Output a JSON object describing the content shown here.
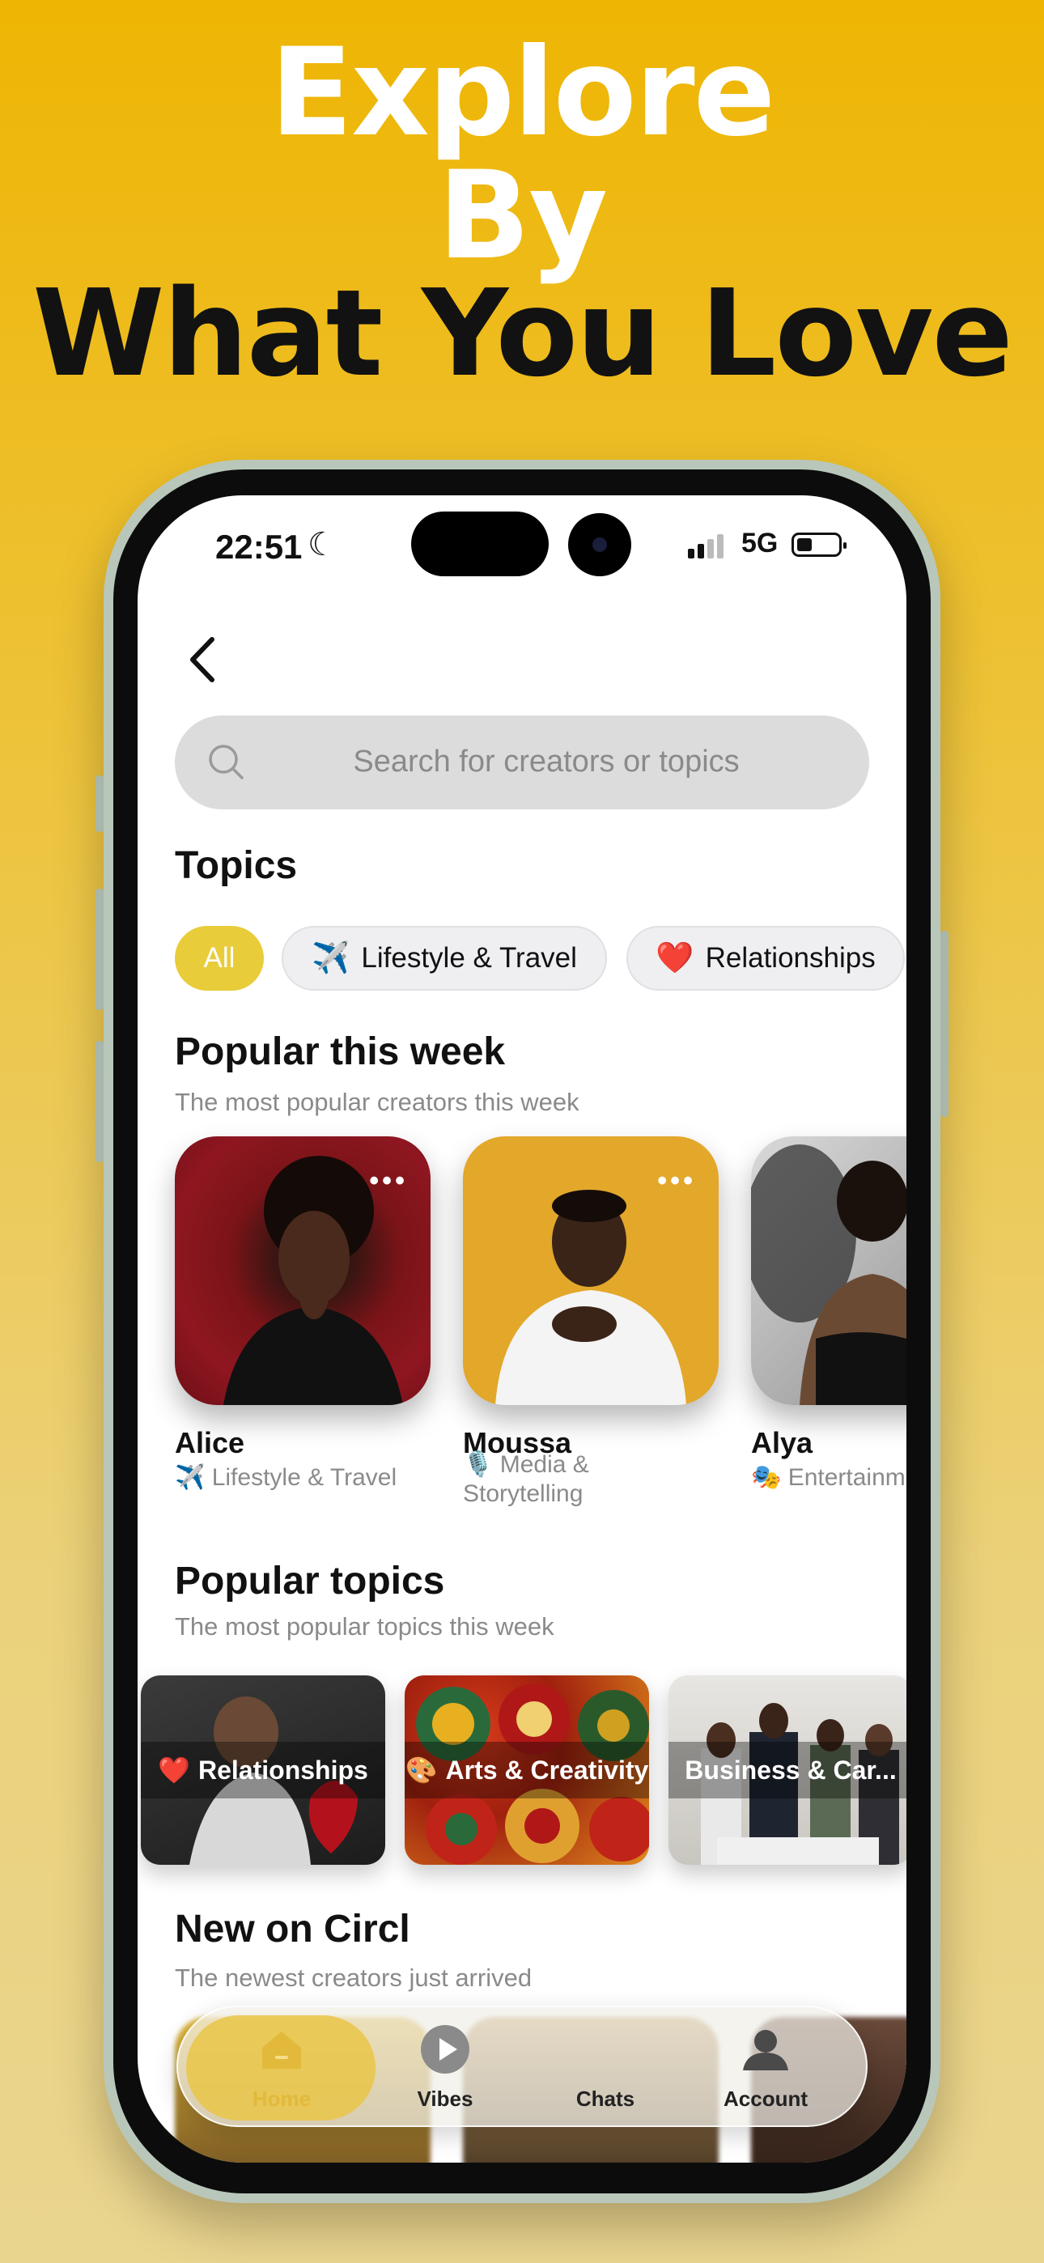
{
  "promo": {
    "line1": "Explore",
    "line2": "By",
    "line3": "What You Love"
  },
  "status_bar": {
    "time": "22:51",
    "network": "5G",
    "icons": [
      "moon-icon",
      "signal-icon",
      "battery-icon"
    ]
  },
  "search": {
    "placeholder": "Search for creators or topics"
  },
  "topics": {
    "title": "Topics",
    "chips": [
      {
        "label": "All",
        "emoji": "",
        "active": true
      },
      {
        "label": "Lifestyle & Travel",
        "emoji": "✈️",
        "active": false
      },
      {
        "label": "Relationships",
        "emoji": "❤️",
        "active": false
      }
    ]
  },
  "popular_week": {
    "title": "Popular this week",
    "subtitle": "The most popular creators this week",
    "creators": [
      {
        "name": "Alice",
        "topic_emoji": "✈️",
        "topic": "Lifestyle & Travel"
      },
      {
        "name": "Moussa",
        "topic_emoji": "🎙️",
        "topic": "Media & Storytelling"
      },
      {
        "name": "Alya",
        "topic_emoji": "🎭",
        "topic": "Entertainm"
      }
    ]
  },
  "popular_topics": {
    "title": "Popular topics",
    "subtitle": "The most popular topics this week",
    "items": [
      {
        "emoji": "❤️",
        "label": "Relationships"
      },
      {
        "emoji": "🎨",
        "label": "Arts & Creativity"
      },
      {
        "emoji": "",
        "label": "Business & Car..."
      }
    ]
  },
  "new_on": {
    "title": "New on Circl",
    "subtitle": "The newest creators just arrived"
  },
  "tab_bar": {
    "tabs": [
      {
        "label": "Home",
        "icon": "home-icon",
        "active": true
      },
      {
        "label": "Vibes",
        "icon": "play-icon",
        "active": false
      },
      {
        "label": "Chats",
        "icon": "chat-icon",
        "active": false
      },
      {
        "label": "Account",
        "icon": "account-icon",
        "active": false
      }
    ]
  },
  "colors": {
    "accent": "#E9CC39",
    "background_top": "#EEB503",
    "background_bottom": "#EAD58F"
  }
}
